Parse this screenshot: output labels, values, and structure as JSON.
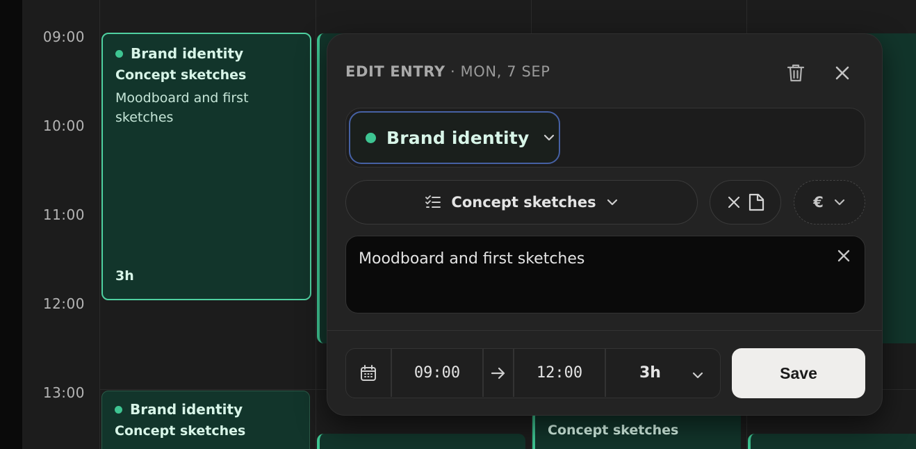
{
  "calendar": {
    "hours": [
      "09:00",
      "10:00",
      "11:00",
      "12:00",
      "13:00"
    ],
    "selected_event": {
      "project": "Brand identity",
      "task": "Concept sketches",
      "note": "Moodboard and first sketches",
      "duration": "3h"
    },
    "lower_event": {
      "project": "Brand identity",
      "task": "Concept sketches"
    },
    "col3_event": {
      "task": "Concept sketches"
    },
    "accent_color": "#3ec592"
  },
  "modal": {
    "title": "EDIT ENTRY",
    "separator": " · ",
    "date": "MON, 7 SEP",
    "project": "Brand identity",
    "task": "Concept sketches",
    "currency_symbol": "€",
    "notes": "Moodboard and first sketches",
    "start_time": "09:00",
    "end_time": "12:00",
    "duration": "3h",
    "save_label": "Save",
    "icons": [
      "trash-icon",
      "close-icon",
      "chevron-down-icon",
      "checklist-icon",
      "no-file-icon",
      "calendar-icon",
      "arrow-right-icon"
    ],
    "focus_color": "#4661a4"
  }
}
